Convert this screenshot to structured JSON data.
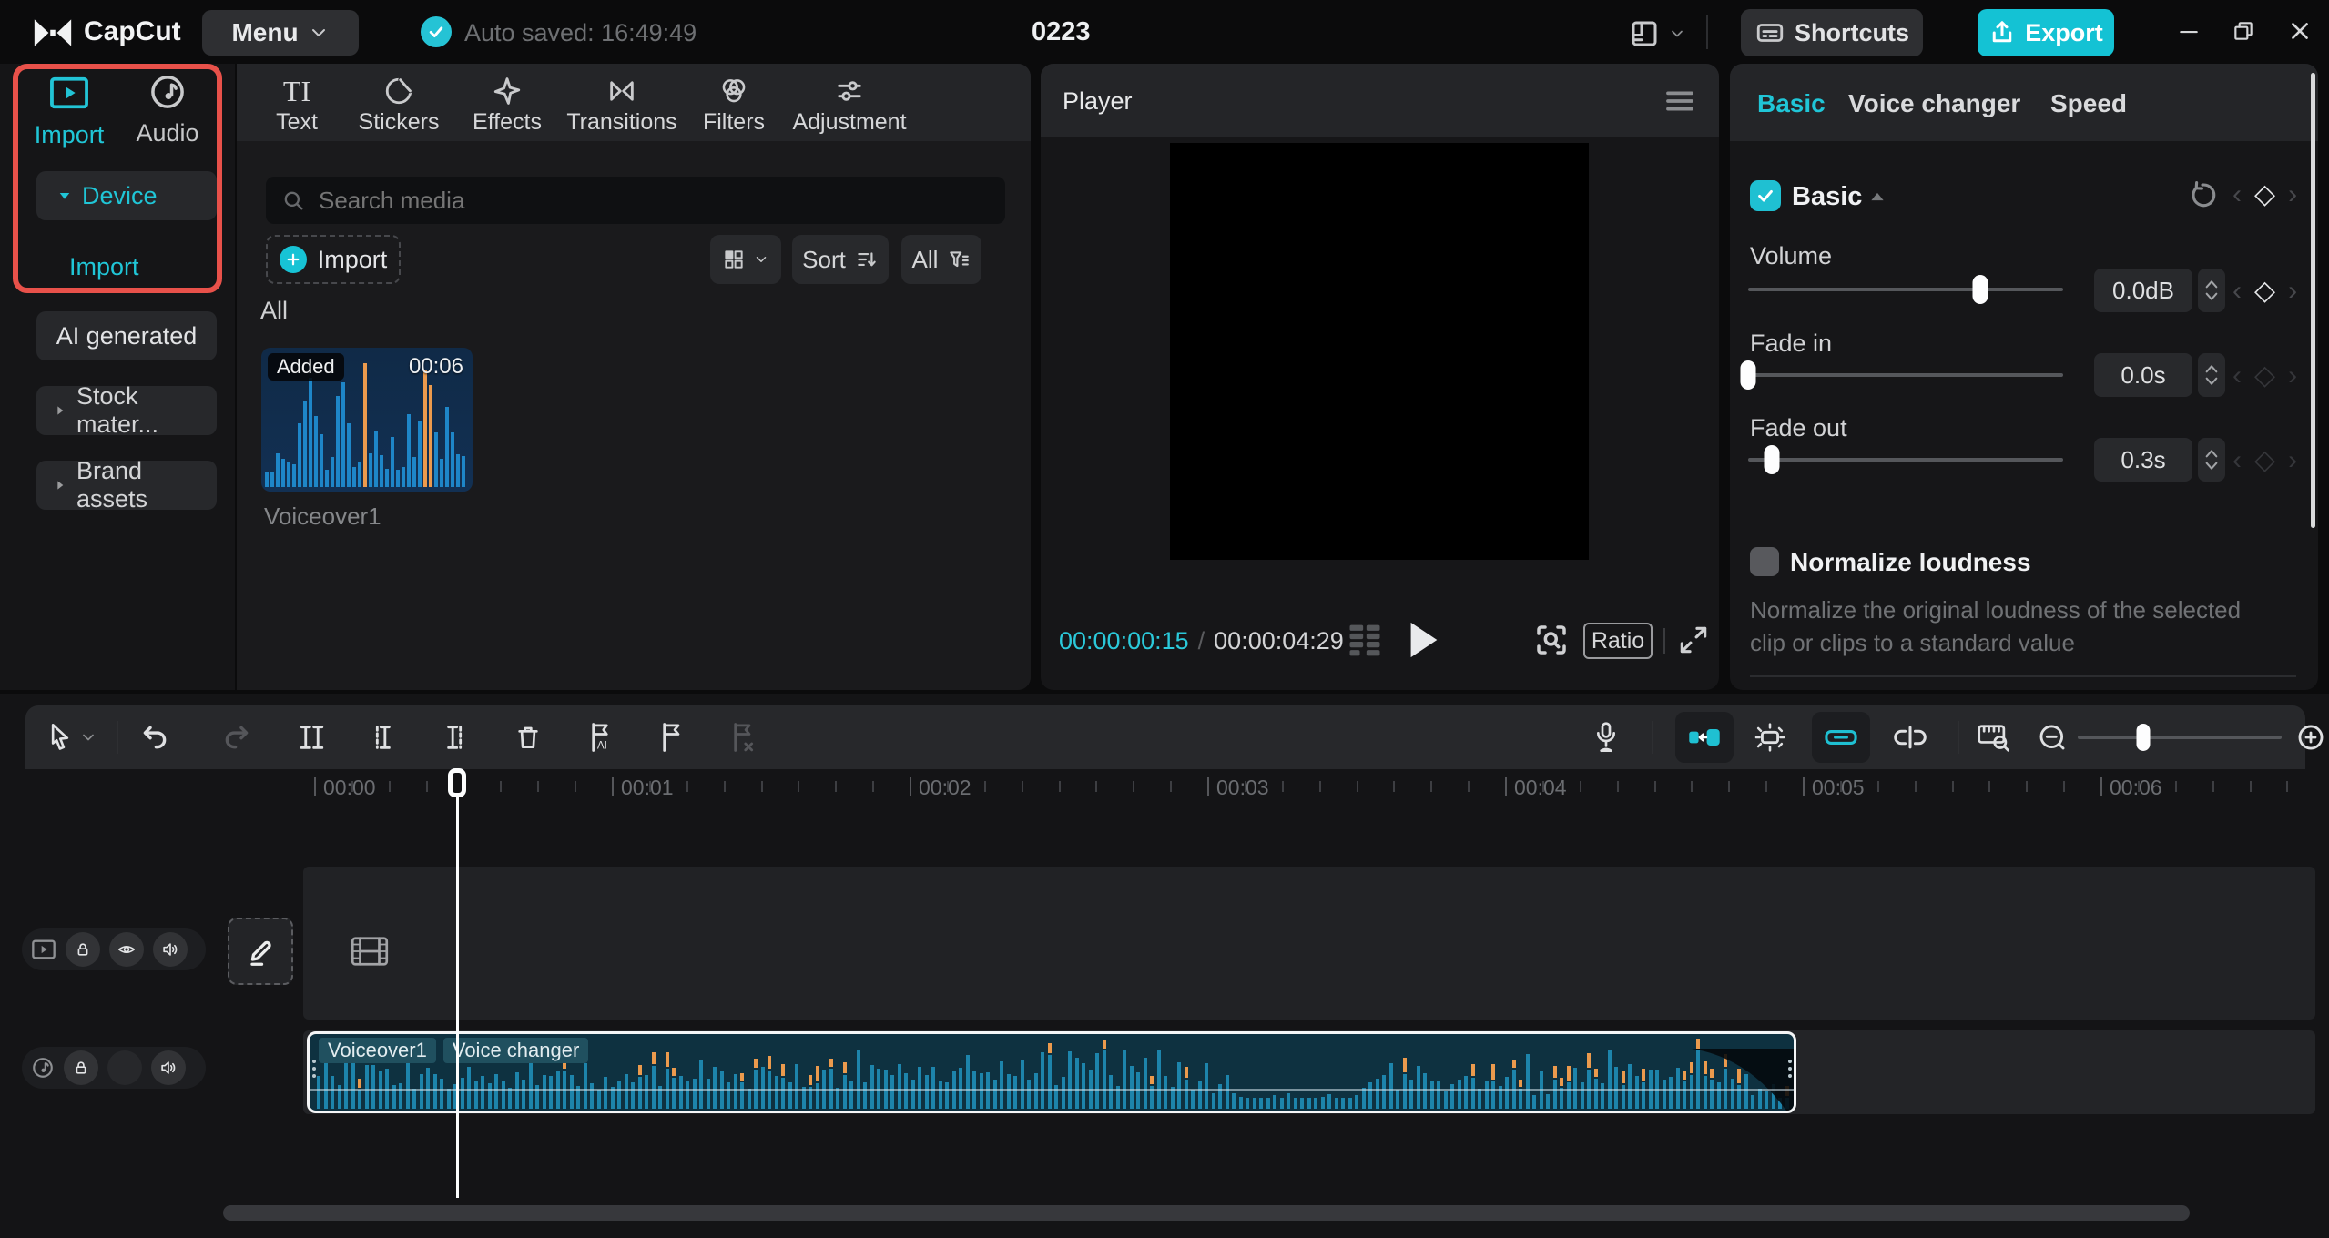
{
  "topbar": {
    "app_name": "CapCut",
    "menu_label": "Menu",
    "autosave_text": "Auto saved: 16:49:49",
    "project_title": "0223",
    "shortcuts_label": "Shortcuts",
    "export_label": "Export"
  },
  "import_sidebar": {
    "tab_import": "Import",
    "tab_audio": "Audio",
    "device_label": "Device",
    "device_import_label": "Import",
    "ai_generated_label": "AI generated",
    "stock_label": "Stock mater...",
    "brand_label": "Brand assets"
  },
  "media_panel": {
    "tabs": [
      "Text",
      "Stickers",
      "Effects",
      "Transitions",
      "Filters",
      "Adjustment"
    ],
    "search_placeholder": "Search media",
    "import_button": "Import",
    "sort_label": "Sort",
    "filter_all_label": "All",
    "section_all": "All",
    "item": {
      "badge": "Added",
      "duration": "00:06",
      "name": "Voiceover1"
    }
  },
  "player": {
    "title": "Player",
    "current_time": "00:00:00:15",
    "separator": "/",
    "duration": "00:00:04:29",
    "ratio_label": "Ratio"
  },
  "properties": {
    "tab_basic": "Basic",
    "tab_voice": "Voice changer",
    "tab_speed": "Speed",
    "section_basic": "Basic",
    "volume": {
      "label": "Volume",
      "value": "0.0dB",
      "percent": 73.7
    },
    "fade_in": {
      "label": "Fade in",
      "value": "0.0s",
      "percent": 0
    },
    "fade_out": {
      "label": "Fade out",
      "value": "0.3s",
      "percent": 7.5
    },
    "normalize": {
      "label": "Normalize loudness",
      "description": "Normalize the original loudness of the selected clip or clips to a standard value"
    }
  },
  "timeline": {
    "ruler": [
      "00:00",
      "00:01",
      "00:02",
      "00:03",
      "00:04",
      "00:05",
      "00:06"
    ],
    "clip": {
      "label1": "Voiceover1",
      "label2": "Voice changer"
    }
  },
  "colors": {
    "accent": "#20c6d7",
    "export_bg": "#14c2d4",
    "highlight_red": "#e8514a",
    "clip_bg": "#0e3140",
    "wave_teal": "#1d84ab",
    "wave_orange": "#eb9a4d"
  }
}
